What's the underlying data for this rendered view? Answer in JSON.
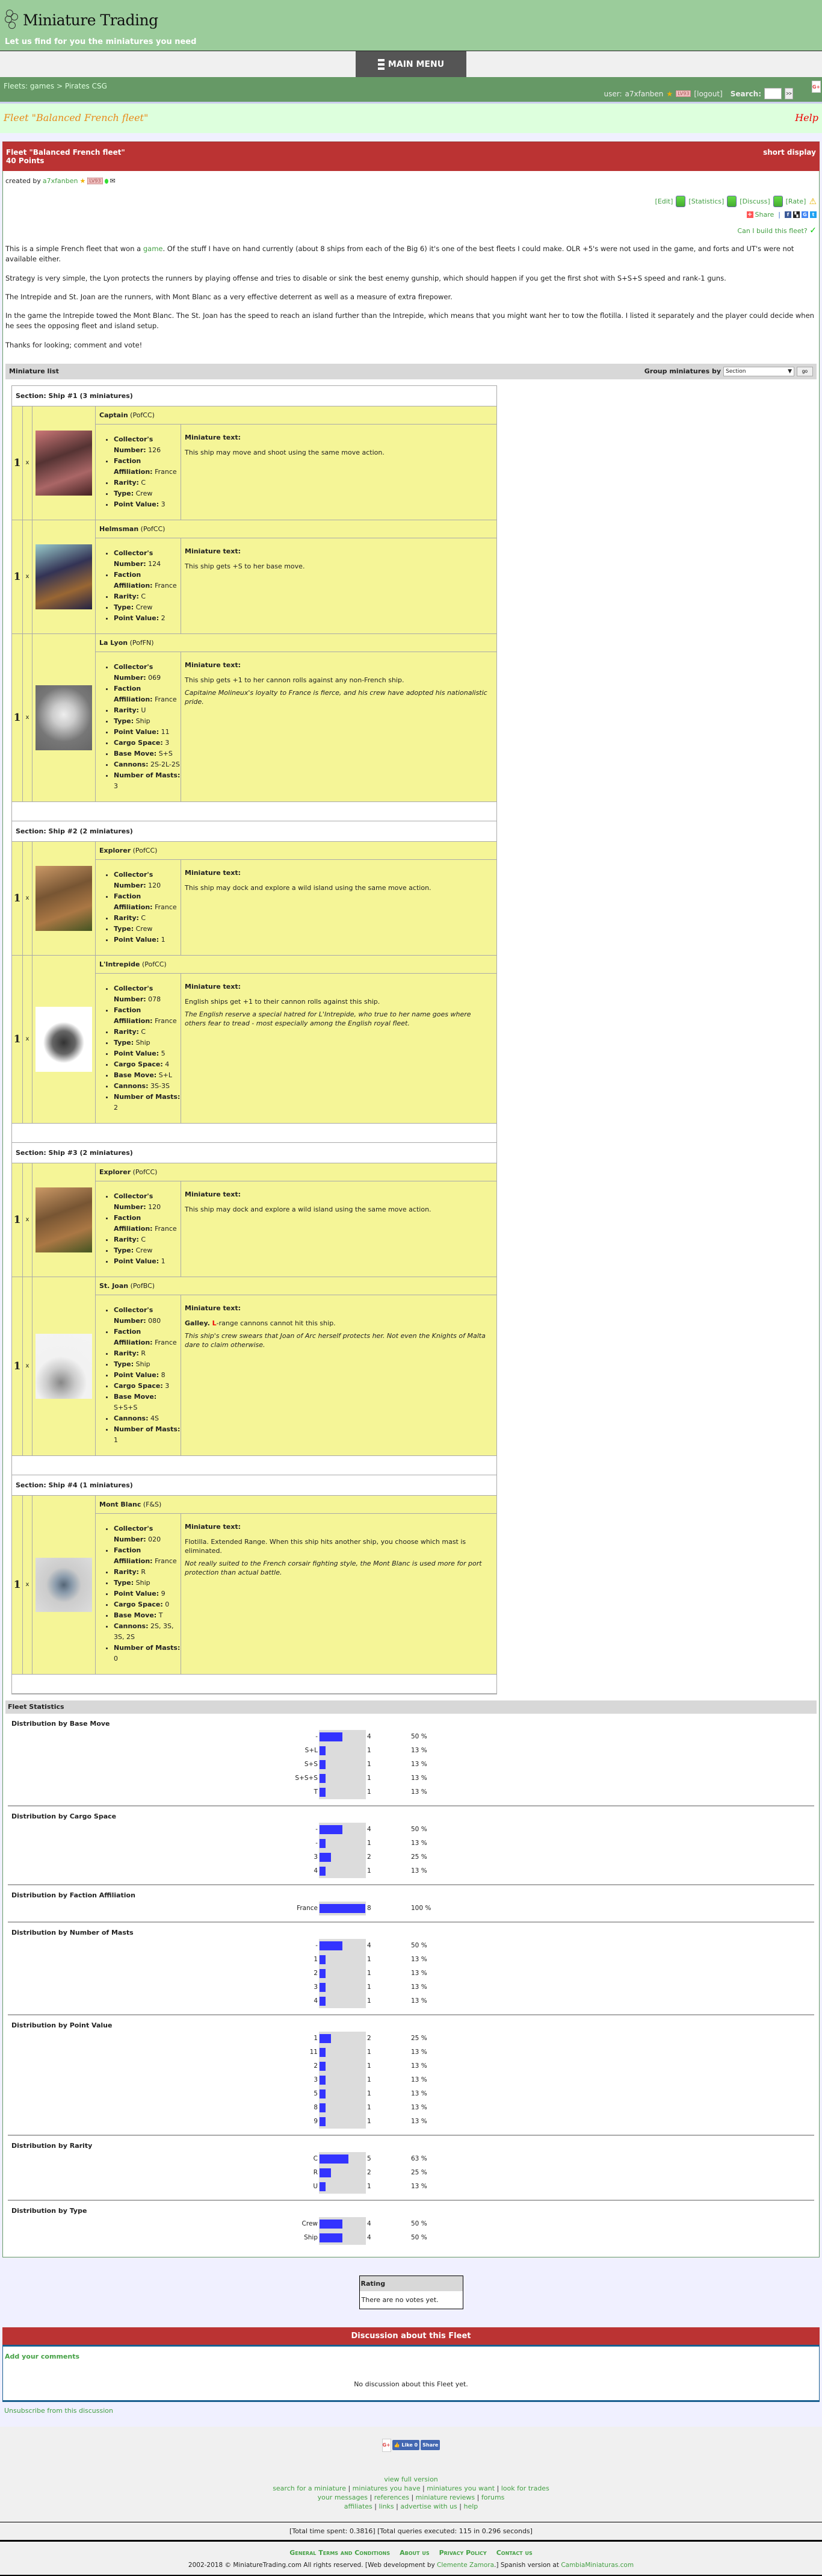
{
  "site": {
    "title": "Miniature Trading",
    "tagline": "Let us find for you the miniatures you need",
    "main_menu": "MAIN MENU"
  },
  "nav": {
    "breadcrumb": [
      "Fleets: games",
      "Pirates CSG"
    ],
    "breadcrumb_sep": ">",
    "user_label": "user:",
    "username": "a7xfanben",
    "level": "LV93",
    "logout": "[logout]",
    "search_label": "Search:",
    "search_value": "",
    "search_go": ">>",
    "gplus": "G+"
  },
  "page": {
    "title": "Fleet \"Balanced French fleet\"",
    "help": "Help"
  },
  "fleet": {
    "name": "Fleet \"Balanced French fleet\"",
    "points": "40 Points",
    "short_display": "short display",
    "created_by_label": "created by",
    "creator": "a7xfanben",
    "creator_level": "LV93",
    "actions": {
      "edit": "[Edit]",
      "statistics": "[Statistics]",
      "discuss": "[Discuss]",
      "rate": "[Rate]"
    },
    "share_label": "Share",
    "can_build": "Can I build this fleet?",
    "description": [
      {
        "before": "This is a simple French fleet that won a ",
        "link": "game",
        "after": ". Of the stuff I have on hand currently (about 8 ships from each of the Big 6) it's one of the best fleets I could make. OLR +5's were not used in the game, and forts and UT's were not available either."
      },
      {
        "before": "Strategy is very simple, the Lyon protects the runners by playing offense and tries to disable or sink the best enemy gunship, which should happen if you get the first shot with S+S+S speed and rank-1 guns.",
        "link": "",
        "after": ""
      },
      {
        "before": "The Intrepide and St. Joan are the runners, with Mont Blanc as a very effective deterrent as well as a measure of extra firepower.",
        "link": "",
        "after": ""
      },
      {
        "before": "In the game the Intrepide towed the Mont Blanc. The St. Joan has the speed to reach an island further than the Intrepide, which means that you might want her to tow the flotilla. I listed it separately and the player could decide when he sees the opposing fleet and island setup.",
        "link": "",
        "after": ""
      },
      {
        "before": "Thanks for looking; comment and vote!",
        "link": "",
        "after": ""
      }
    ]
  },
  "miniature_list": {
    "title": "Miniature list",
    "group_by_label": "Group miniatures by",
    "group_by_value": "Section",
    "go": "go",
    "text_heading": "Miniature text:",
    "times": "x",
    "sections": [
      {
        "title": "Section: Ship #1 (3 miniatures)",
        "minis": [
          {
            "qty": "1",
            "name": "Captain",
            "set": "(PofCC)",
            "image": "captain-portrait",
            "stats": [
              [
                "Collector's Number:",
                "126"
              ],
              [
                "Faction Affiliation:",
                "France"
              ],
              [
                "Rarity:",
                "C"
              ],
              [
                "Type:",
                "Crew"
              ],
              [
                "Point Value:",
                "3"
              ]
            ],
            "text": "This ship may move and shoot using the same move action.",
            "flavor": ""
          },
          {
            "qty": "1",
            "name": "Helmsman",
            "set": "(PofCC)",
            "image": "helmsman-portrait",
            "stats": [
              [
                "Collector's Number:",
                "124"
              ],
              [
                "Faction Affiliation:",
                "France"
              ],
              [
                "Rarity:",
                "C"
              ],
              [
                "Type:",
                "Crew"
              ],
              [
                "Point Value:",
                "2"
              ]
            ],
            "text": "This ship gets +S to her base move.",
            "flavor": ""
          },
          {
            "qty": "1",
            "name": "La Lyon",
            "set": "(PofFN)",
            "image": "la-lyon-ship",
            "stats": [
              [
                "Collector's Number:",
                "069"
              ],
              [
                "Faction Affiliation:",
                "France"
              ],
              [
                "Rarity:",
                "U"
              ],
              [
                "Type:",
                "Ship"
              ],
              [
                "Point Value:",
                "11"
              ],
              [
                "Cargo Space:",
                "3"
              ],
              [
                "Base Move:",
                "S+S"
              ],
              [
                "Cannons:",
                "2S-2L-2S"
              ],
              [
                "Number of Masts:",
                "3"
              ]
            ],
            "text": "This ship gets +1 to her cannon rolls against any non-French ship.",
            "flavor": "Capitaine Molineux's loyalty to France is fierce, and his crew have adopted his nationalistic pride."
          }
        ]
      },
      {
        "title": "Section: Ship #2 (2 miniatures)",
        "minis": [
          {
            "qty": "1",
            "name": "Explorer",
            "set": "(PofCC)",
            "image": "explorer-portrait",
            "stats": [
              [
                "Collector's Number:",
                "120"
              ],
              [
                "Faction Affiliation:",
                "France"
              ],
              [
                "Rarity:",
                "C"
              ],
              [
                "Type:",
                "Crew"
              ],
              [
                "Point Value:",
                "1"
              ]
            ],
            "text": "This ship may dock and explore a wild island using the same move action.",
            "flavor": ""
          },
          {
            "qty": "1",
            "name": "L'Intrepide",
            "set": "(PofCC)",
            "image": "lintrepide-ship",
            "stats": [
              [
                "Collector's Number:",
                "078"
              ],
              [
                "Faction Affiliation:",
                "France"
              ],
              [
                "Rarity:",
                "C"
              ],
              [
                "Type:",
                "Ship"
              ],
              [
                "Point Value:",
                "5"
              ],
              [
                "Cargo Space:",
                "4"
              ],
              [
                "Base Move:",
                "S+L"
              ],
              [
                "Cannons:",
                "3S-3S"
              ],
              [
                "Number of Masts:",
                "2"
              ]
            ],
            "text": "English ships get +1 to their cannon rolls against this ship.",
            "flavor": "The English reserve a special hatred for L'Intrepide, who true to her name goes where others fear to tread - most especially among the English royal fleet."
          }
        ]
      },
      {
        "title": "Section: Ship #3 (2 miniatures)",
        "minis": [
          {
            "qty": "1",
            "name": "Explorer",
            "set": "(PofCC)",
            "image": "explorer-portrait",
            "stats": [
              [
                "Collector's Number:",
                "120"
              ],
              [
                "Faction Affiliation:",
                "France"
              ],
              [
                "Rarity:",
                "C"
              ],
              [
                "Type:",
                "Crew"
              ],
              [
                "Point Value:",
                "1"
              ]
            ],
            "text": "This ship may dock and explore a wild island using the same move action.",
            "flavor": ""
          },
          {
            "qty": "1",
            "name": "St. Joan",
            "set": "(PofBC)",
            "image": "st-joan-ship",
            "stats": [
              [
                "Collector's Number:",
                "080"
              ],
              [
                "Faction Affiliation:",
                "France"
              ],
              [
                "Rarity:",
                "R"
              ],
              [
                "Type:",
                "Ship"
              ],
              [
                "Point Value:",
                "8"
              ],
              [
                "Cargo Space:",
                "3"
              ],
              [
                "Base Move:",
                "S+S+S"
              ],
              [
                "Cannons:",
                "4S"
              ],
              [
                "Number of Masts:",
                "1"
              ]
            ],
            "text_prefix": "Galley.",
            "text_red": "L",
            "text": "-range cannons cannot hit this ship.",
            "flavor": "This ship's crew swears that Joan of Arc herself protects her. Not even the Knights of Malta dare to claim otherwise."
          }
        ]
      },
      {
        "title": "Section: Ship #4 (1 miniatures)",
        "minis": [
          {
            "qty": "1",
            "name": "Mont Blanc",
            "set": "(F&S)",
            "image": "mont-blanc-ship",
            "stats": [
              [
                "Collector's Number:",
                "020"
              ],
              [
                "Faction Affiliation:",
                "France"
              ],
              [
                "Rarity:",
                "R"
              ],
              [
                "Type:",
                "Ship"
              ],
              [
                "Point Value:",
                "9"
              ],
              [
                "Cargo Space:",
                "0"
              ],
              [
                "Base Move:",
                "T"
              ],
              [
                "Cannons:",
                "2S, 3S, 3S, 2S"
              ],
              [
                "Number of Masts:",
                "0"
              ]
            ],
            "text": "Flotilla. Extended Range. When this ship hits another ship, you choose which mast is eliminated.",
            "flavor": "Not really suited to the French corsair fighting style, the Mont Blanc is used more for port protection than actual battle."
          }
        ]
      }
    ]
  },
  "chart_data": [
    {
      "type": "bar",
      "title": "Distribution by Base Move",
      "categories": [
        "-",
        "S+L",
        "S+S",
        "S+S+S",
        "T"
      ],
      "values": [
        4,
        1,
        1,
        1,
        1
      ],
      "percents": [
        "50 %",
        "13 %",
        "13 %",
        "13 %",
        "13 %"
      ],
      "xlim": [
        0,
        8
      ]
    },
    {
      "type": "bar",
      "title": "Distribution by Cargo Space",
      "categories": [
        "-",
        "-",
        "3",
        "4"
      ],
      "values": [
        4,
        1,
        2,
        1
      ],
      "percents": [
        "50 %",
        "13 %",
        "25 %",
        "13 %"
      ],
      "xlim": [
        0,
        8
      ]
    },
    {
      "type": "bar",
      "title": "Distribution by Faction Affiliation",
      "categories": [
        "France"
      ],
      "values": [
        8
      ],
      "percents": [
        "100 %"
      ],
      "xlim": [
        0,
        8
      ]
    },
    {
      "type": "bar",
      "title": "Distribution by Number of Masts",
      "categories": [
        "-",
        "1",
        "2",
        "3",
        "4"
      ],
      "values": [
        4,
        1,
        1,
        1,
        1
      ],
      "percents": [
        "50 %",
        "13 %",
        "13 %",
        "13 %",
        "13 %"
      ],
      "xlim": [
        0,
        8
      ]
    },
    {
      "type": "bar",
      "title": "Distribution by Point Value",
      "categories": [
        "1",
        "11",
        "2",
        "3",
        "5",
        "8",
        "9"
      ],
      "values": [
        2,
        1,
        1,
        1,
        1,
        1,
        1
      ],
      "percents": [
        "25 %",
        "13 %",
        "13 %",
        "13 %",
        "13 %",
        "13 %",
        "13 %"
      ],
      "xlim": [
        0,
        8
      ]
    },
    {
      "type": "bar",
      "title": "Distribution by Rarity",
      "categories": [
        "C",
        "R",
        "U"
      ],
      "values": [
        5,
        2,
        1
      ],
      "percents": [
        "63 %",
        "25 %",
        "13 %"
      ],
      "xlim": [
        0,
        8
      ]
    },
    {
      "type": "bar",
      "title": "Distribution by Type",
      "categories": [
        "Crew",
        "Ship"
      ],
      "values": [
        4,
        4
      ],
      "percents": [
        "50 %",
        "50 %"
      ],
      "xlim": [
        0,
        8
      ]
    }
  ],
  "fleet_statistics_title": "Fleet Statistics",
  "bar_color": "#3333ff",
  "rating": {
    "title": "Rating",
    "body": "There are no votes yet."
  },
  "discussion": {
    "title": "Discussion about this Fleet",
    "add_comments": "Add your comments",
    "empty": "No discussion about this Fleet yet.",
    "unsubscribe": "Unsubscribe from this discussion"
  },
  "footer": {
    "like": "Like 0",
    "share": "Share",
    "gplus": "G+",
    "view_full": "view full version",
    "link_rows": [
      [
        "search for a miniature",
        "miniatures you have",
        "miniatures you want",
        "look for trades"
      ],
      [
        "your messages",
        "references",
        "miniature reviews",
        "forums"
      ],
      [
        "affiliates",
        "links",
        "advertise with us",
        "help"
      ]
    ],
    "timing": "[Total time spent: 0.3816] [Total queries executed: 115 in 0.296 seconds]",
    "legal_links": [
      "General Terms and Conditions",
      "About us",
      "Privacy Policy",
      "Contact us"
    ],
    "copyright_pre": "2002-2018 © MiniatureTrading.com All rights reserved. [Web development by ",
    "dev_name": "Clemente Zamora",
    "copyright_mid": ".] Spanish version at ",
    "spanish_site": "CambiaMiniaturas.com"
  }
}
